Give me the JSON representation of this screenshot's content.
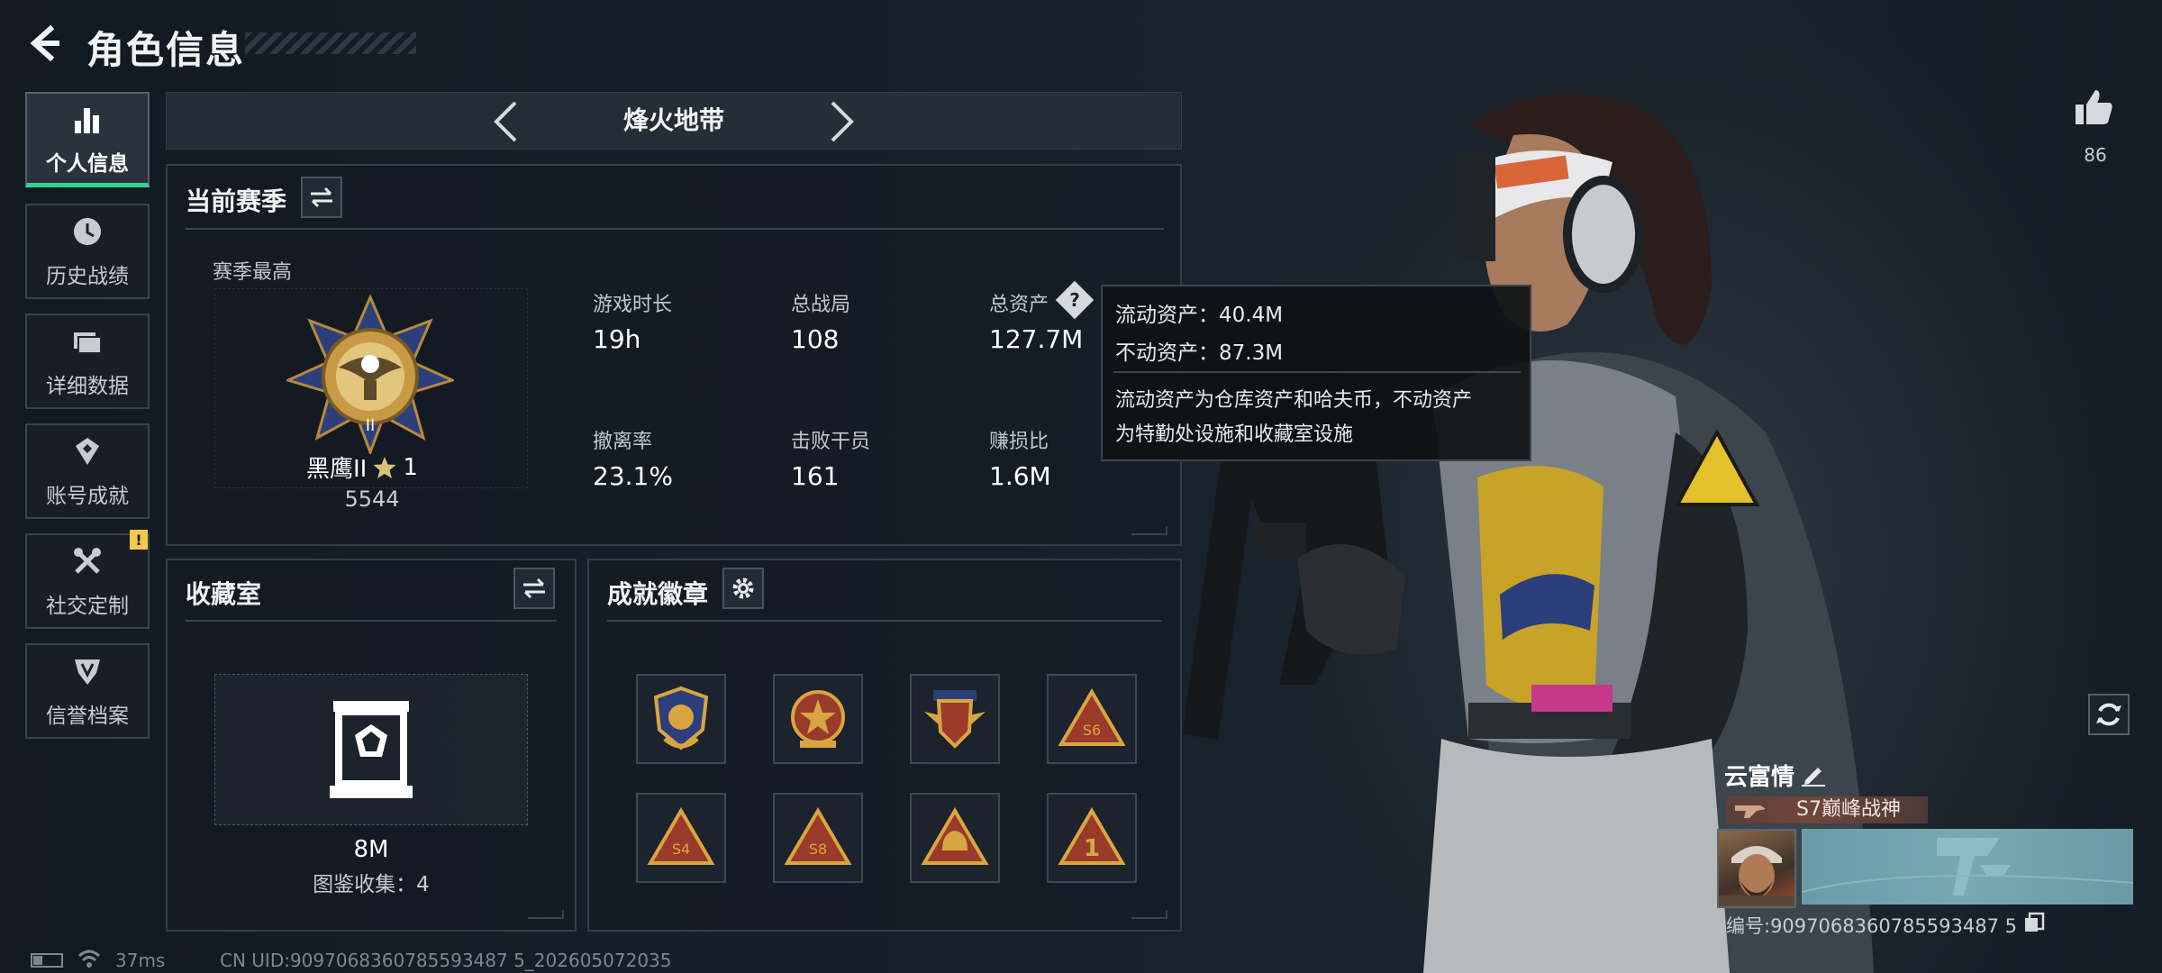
{
  "header": {
    "title": "角色信息"
  },
  "nav": {
    "items": [
      {
        "label": "个人信息",
        "icon": "bar-chart-icon",
        "active": true
      },
      {
        "label": "历史战绩",
        "icon": "clock-icon"
      },
      {
        "label": "详细数据",
        "icon": "folder-icon"
      },
      {
        "label": "账号成就",
        "icon": "achievement-icon"
      },
      {
        "label": "社交定制",
        "icon": "tools-icon",
        "badge": "!"
      },
      {
        "label": "信誉档案",
        "icon": "shield-v-icon"
      }
    ]
  },
  "mode": {
    "name": "烽火地带"
  },
  "season": {
    "title": "当前赛季",
    "best_label": "赛季最高",
    "rank_name": "黑鹰II",
    "rank_stars": "1",
    "rank_score": "5544",
    "stats": [
      {
        "label": "游戏时长",
        "value": "19h"
      },
      {
        "label": "总战局",
        "value": "108"
      },
      {
        "label": "总资产",
        "value": "127.7M"
      },
      {
        "label": "撤离率",
        "value": "23.1%"
      },
      {
        "label": "击败干员",
        "value": "161"
      },
      {
        "label": "赚损比",
        "value": "1.6M"
      }
    ],
    "help_glyph": "?"
  },
  "tooltip": {
    "liquid": "流动资产：40.4M",
    "fixed": "不动资产：87.3M",
    "desc_line1": "流动资产为仓库资产和哈夫币，不动资产",
    "desc_line2": "为特勤处设施和收藏室设施"
  },
  "collection": {
    "title": "收藏室",
    "value": "8M",
    "count_label": "图鉴收集：4"
  },
  "badges": {
    "title": "成就徽章",
    "items": [
      "blue-crest-badge",
      "star-emblem-badge",
      "winged-shield-badge",
      "s6-triangle-badge",
      "s4-triangle-badge",
      "s8-triangle-badge",
      "helmet-triangle-badge",
      "one-triangle-badge"
    ],
    "colors": {
      "gold": "#d8a640",
      "red": "#9a3a2a",
      "blue": "#2c3f7c"
    }
  },
  "profile": {
    "like_count": "86",
    "name": "云富情",
    "title": "S7巅峰战神",
    "uid": "编号:9097068360785593487 5"
  },
  "status": {
    "ping": "37ms",
    "cn_uid": "CN UID:9097068360785593487 5_202605072035"
  },
  "theme": {
    "accent": "#2fd38f",
    "warning": "#f2c94c"
  }
}
